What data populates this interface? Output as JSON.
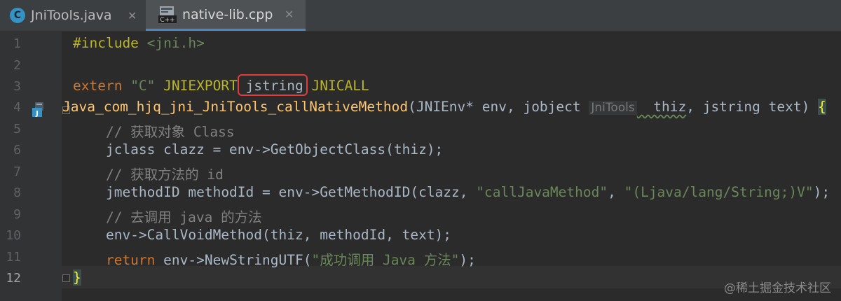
{
  "tabs": [
    {
      "label": "JniTools.java",
      "icon": "c-class-icon"
    },
    {
      "label": "native-lib.cpp",
      "icon": "cpp-file-icon",
      "active": true
    }
  ],
  "lines": {
    "numbers": [
      "1",
      "2",
      "3",
      "4",
      "5",
      "6",
      "7",
      "8",
      "9",
      "10",
      "11",
      "12"
    ],
    "l1_pp": "#include",
    "l1_hdr": " <jni.h>",
    "l3_kw": "extern",
    "l3_str": " \"C\"",
    "l3_a": " JNIEXPORT ",
    "l3_b": "jstring",
    "l3_c": " JNICALL",
    "l4_fn": "Java_com_hjq_jni_JniTools_callNativeMethod",
    "l4_a": "(JNIEnv* env, jobject ",
    "l4_hint": "JniTools",
    "l4_b": "  thiz",
    "l4_c": ", jstring text) ",
    "l4_brace": "{",
    "l5": "    // 获取对象 Class",
    "l6": "    jclass clazz = env->GetObjectClass(thiz);",
    "l7": "    // 获取方法的 id",
    "l8_a": "    jmethodID methodId = env->GetMethodID(clazz, ",
    "l8_s1": "\"callJavaMethod\"",
    "l8_b": ", ",
    "l8_s2": "\"(Ljava/lang/String;)V\"",
    "l8_c": ");",
    "l9": "    // 去调用 java 的方法",
    "l10": "    env->CallVoidMethod(thiz, methodId, text);",
    "l11_kw": "    return",
    "l11_a": " env->NewStringUTF(",
    "l11_s": "\"成功调用 Java 方法\"",
    "l11_b": ");",
    "l12": "}"
  },
  "watermark": "@稀土掘金技术社区",
  "colors": {
    "highlight_box": "#e23c3c",
    "tab_active_underline": "#4a88c7"
  }
}
